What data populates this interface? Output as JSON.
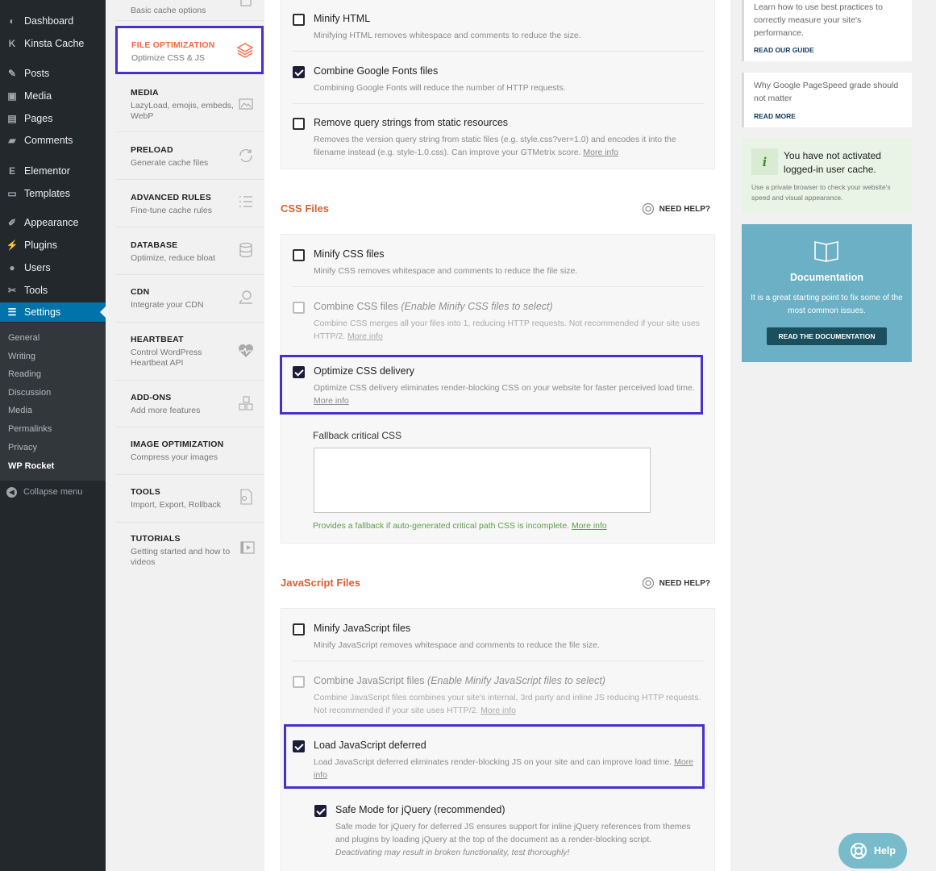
{
  "admin_menu": {
    "items": [
      {
        "label": "Dashboard",
        "icon": "dashboard-icon",
        "glyph": "◐"
      },
      {
        "label": "Kinsta Cache",
        "icon": "kinsta-icon",
        "glyph": "K"
      },
      {
        "label": "Posts",
        "icon": "pin-icon",
        "glyph": "✎"
      },
      {
        "label": "Media",
        "icon": "media-icon",
        "glyph": "▣"
      },
      {
        "label": "Pages",
        "icon": "pages-icon",
        "glyph": "▤"
      },
      {
        "label": "Comments",
        "icon": "comments-icon",
        "glyph": "▰"
      },
      {
        "label": "Elementor",
        "icon": "elementor-icon",
        "glyph": "E"
      },
      {
        "label": "Templates",
        "icon": "folder-icon",
        "glyph": "▭"
      },
      {
        "label": "Appearance",
        "icon": "brush-icon",
        "glyph": "✐"
      },
      {
        "label": "Plugins",
        "icon": "plug-icon",
        "glyph": "⚡"
      },
      {
        "label": "Users",
        "icon": "user-icon",
        "glyph": "●"
      },
      {
        "label": "Tools",
        "icon": "wrench-icon",
        "glyph": "✂"
      },
      {
        "label": "Settings",
        "icon": "settings-icon",
        "glyph": "☰"
      }
    ],
    "submenu": [
      "General",
      "Writing",
      "Reading",
      "Discussion",
      "Media",
      "Permalinks",
      "Privacy",
      "WP Rocket"
    ],
    "collapse_label": "Collapse menu"
  },
  "rocket_nav": {
    "top_partial": "Basic cache options",
    "active": {
      "title": "FILE OPTIMIZATION",
      "subtitle": "Optimize CSS & JS",
      "icon": "layers-icon"
    },
    "items": [
      {
        "title": "MEDIA",
        "subtitle": "LazyLoad, emojis, embeds, WebP",
        "icon": "image-icon"
      },
      {
        "title": "PRELOAD",
        "subtitle": "Generate cache files",
        "icon": "refresh-icon"
      },
      {
        "title": "ADVANCED RULES",
        "subtitle": "Fine-tune cache rules",
        "icon": "list-icon"
      },
      {
        "title": "DATABASE",
        "subtitle": "Optimize, reduce bloat",
        "icon": "database-icon"
      },
      {
        "title": "CDN",
        "subtitle": "Integrate your CDN",
        "icon": "cdn-icon"
      },
      {
        "title": "HEARTBEAT",
        "subtitle": "Control WordPress Heartbeat API",
        "icon": "heart-icon"
      },
      {
        "title": "ADD-ONS",
        "subtitle": "Add more features",
        "icon": "cubes-icon"
      },
      {
        "title": "IMAGE OPTIMIZATION",
        "subtitle": "Compress your images",
        "icon": ""
      },
      {
        "title": "TOOLS",
        "subtitle": "Import, Export, Rollback",
        "icon": "file-gear-icon"
      },
      {
        "title": "TUTORIALS",
        "subtitle": "Getting started and how to videos",
        "icon": "play-icon"
      }
    ]
  },
  "html_section": {
    "minify_html": {
      "label": "Minify HTML",
      "desc": "Minifying HTML removes whitespace and comments to reduce the size.",
      "checked": false
    },
    "combine_fonts": {
      "label": "Combine Google Fonts files",
      "desc": "Combining Google Fonts will reduce the number of HTTP requests.",
      "checked": true
    },
    "remove_qs": {
      "label": "Remove query strings from static resources",
      "desc": "Removes the version query string from static files (e.g. style.css?ver=1.0) and encodes it into the filename instead (e.g. style-1.0.css). Can improve your GTMetrix score.",
      "more": "More info",
      "checked": false
    }
  },
  "css_section": {
    "title": "CSS Files",
    "need_help": "NEED HELP?",
    "minify_css": {
      "label": "Minify CSS files",
      "desc": "Minify CSS removes whitespace and comments to reduce the file size.",
      "checked": false
    },
    "combine_css": {
      "label": "Combine CSS files",
      "label_em": "(Enable Minify CSS files to select)",
      "desc": "Combine CSS merges all your files into 1, reducing HTTP requests. Not recommended if your site uses HTTP/2.",
      "more": "More info",
      "checked": false
    },
    "optimize_delivery": {
      "label": "Optimize CSS delivery",
      "desc": "Optimize CSS delivery eliminates render-blocking CSS on your website for faster perceived load time.",
      "more": "More info",
      "checked": true
    },
    "fallback": {
      "label": "Fallback critical CSS",
      "value": "",
      "hint": "Provides a fallback if auto-generated critical path CSS is incomplete.",
      "more": "More info"
    }
  },
  "js_section": {
    "title": "JavaScript Files",
    "need_help": "NEED HELP?",
    "minify_js": {
      "label": "Minify JavaScript files",
      "desc": "Minify JavaScript removes whitespace and comments to reduce the file size.",
      "checked": false
    },
    "combine_js": {
      "label": "Combine JavaScript files",
      "label_em": "(Enable Minify JavaScript files to select)",
      "desc": "Combine JavaScript files combines your site's internal, 3rd party and inline JS reducing HTTP requests. Not recommended if your site uses HTTP/2.",
      "more": "More info",
      "checked": false
    },
    "defer_js": {
      "label": "Load JavaScript deferred",
      "desc": "Load JavaScript deferred eliminates render-blocking JS on your site and can improve load time.",
      "more": "More info",
      "checked": true
    },
    "safe_mode": {
      "label": "Safe Mode for jQuery (recommended)",
      "desc": "Safe mode for jQuery for deferred JS ensures support for inline jQuery references from themes and plugins by loading jQuery at the top of the document as a render-blocking script.",
      "desc_em": "Deactivating may result in broken functionality, test thoroughly!",
      "checked": true
    }
  },
  "right_sidebar": {
    "guide_card": {
      "text": "Learn how to use best practices to correctly measure your site's performance.",
      "link": "READ OUR GUIDE"
    },
    "pagespeed_card": {
      "text": "Why Google PageSpeed grade should not matter",
      "link": "READ MORE"
    },
    "info": {
      "icon_letter": "i",
      "title": "You have not activated logged-in user cache.",
      "desc": "Use a private browser to check your website's speed and visual appearance."
    },
    "documentation": {
      "title": "Documentation",
      "desc": "It is a great starting point to fix some of the most common issues.",
      "button": "READ THE DOCUMENTATION"
    }
  },
  "help_button": {
    "label": "Help"
  },
  "colors": {
    "accent_orange": "#d56138",
    "highlight_purple": "#4b2fc9",
    "wp_blue": "#0073aa",
    "doc_teal": "#6bb0c4"
  }
}
